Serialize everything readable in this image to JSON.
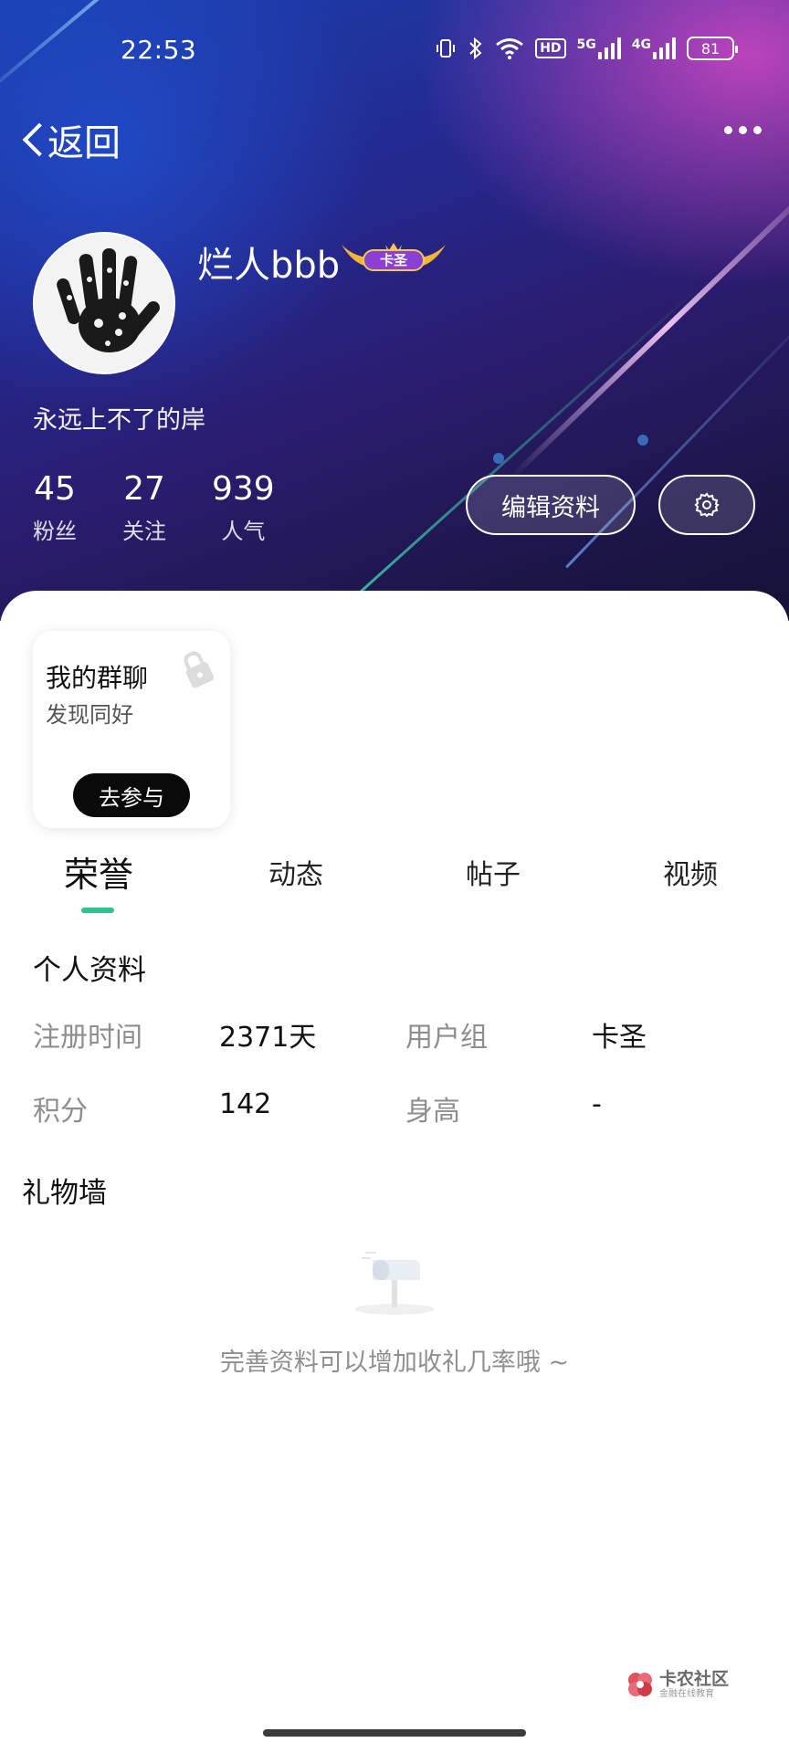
{
  "status_bar": {
    "time": "22:53",
    "hd_label": "HD",
    "net1_label": "5G",
    "net2_label": "4G",
    "battery": "81"
  },
  "nav": {
    "back_label": "返回"
  },
  "profile": {
    "username": "烂人bbb",
    "badge_label": "卡圣",
    "bio": "永远上不了的岸",
    "stats": [
      {
        "value": "45",
        "label": "粉丝"
      },
      {
        "value": "27",
        "label": "关注"
      },
      {
        "value": "939",
        "label": "人气"
      }
    ],
    "edit_label": "编辑资料"
  },
  "group_card": {
    "title": "我的群聊",
    "subtitle": "发现同好",
    "button": "去参与"
  },
  "tabs": [
    {
      "label": "荣誉",
      "active": true
    },
    {
      "label": "动态",
      "active": false
    },
    {
      "label": "帖子",
      "active": false
    },
    {
      "label": "视频",
      "active": false
    }
  ],
  "personal_info": {
    "title": "个人资料",
    "rows": [
      {
        "label1": "注册时间",
        "value1": "2371天",
        "label2": "用户组",
        "value2": "卡圣"
      },
      {
        "label1": "积分",
        "value1": "142",
        "label2": "身高",
        "value2": "-"
      }
    ]
  },
  "gift_wall": {
    "title": "礼物墙",
    "empty_text": "完善资料可以增加收礼几率哦 ~"
  },
  "watermark": {
    "name": "卡农社区",
    "tagline": "金融在线教育"
  },
  "colors": {
    "accent": "#2ec28f",
    "banner_dark": "#1c1547",
    "banner_blue": "#1b3fae",
    "banner_pink": "#d648c4"
  }
}
